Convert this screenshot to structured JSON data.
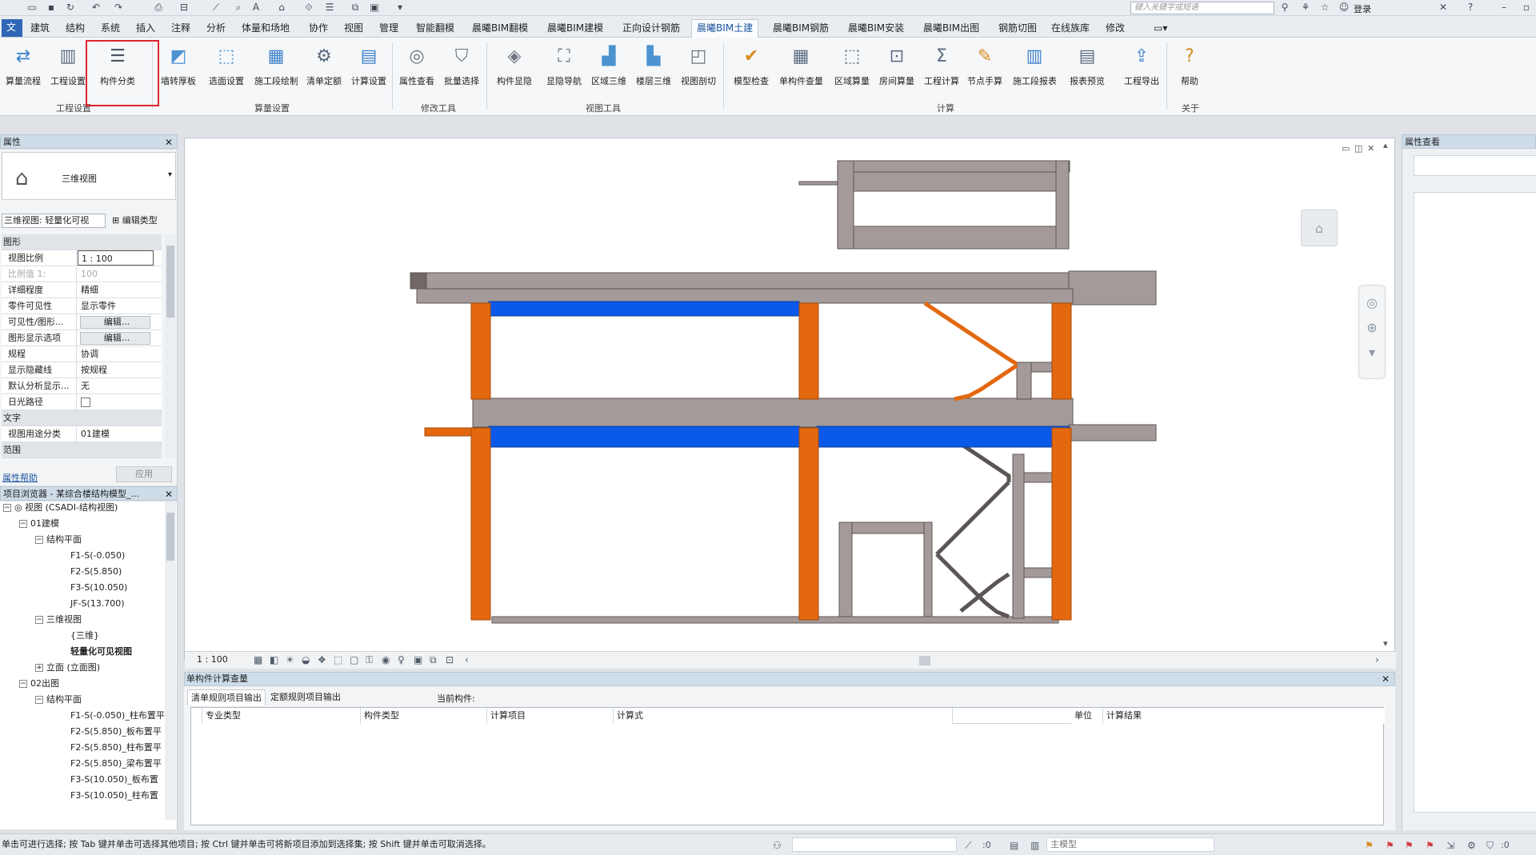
{
  "search": {
    "placeholder": "键入关键字或短语"
  },
  "login": "登录",
  "tabs": [
    "建筑",
    "结构",
    "系统",
    "插入",
    "注释",
    "分析",
    "体量和场地",
    "协作",
    "视图",
    "管理",
    "智能翻模",
    "晨曦BIM翻模",
    "晨曦BIM建模",
    "正向设计钢筋",
    "晨曦BIM土建",
    "晨曦BIM钢筋",
    "晨曦BIM安装",
    "晨曦BIM出图",
    "钢筋切图",
    "在线族库",
    "修改"
  ],
  "ribbon": {
    "buttons": [
      "算量流程",
      "工程设置",
      "构件分类",
      "墙转厚板",
      "选面设置",
      "施工段绘制",
      "清单定额",
      "计算设置",
      "属性查看",
      "批量选择",
      "构件显隐",
      "显隐导航",
      "区域三维",
      "楼层三维",
      "视图剖切",
      "模型检查",
      "单构件查量",
      "区域算量",
      "房间算量",
      "工程计算",
      "节点手算",
      "施工段报表",
      "报表预览",
      "工程导出",
      "帮助"
    ],
    "groups": [
      "工程设置",
      "算量设置",
      "修改工具",
      "视图工具",
      "计算",
      "关于"
    ]
  },
  "properties": {
    "title": "属性",
    "type_name": "三维视图",
    "instance": "三维视图: 轻量化可视",
    "edit_type": "编辑类型",
    "sections": {
      "graphics": "图形",
      "text": "文字",
      "range": "范围"
    },
    "rows": [
      {
        "name": "视图比例",
        "value": "1 : 100"
      },
      {
        "name": "比例值 1:",
        "value": "100"
      },
      {
        "name": "详细程度",
        "value": "精细"
      },
      {
        "name": "零件可见性",
        "value": "显示零件"
      },
      {
        "name": "可见性/图形...",
        "value": "编辑..."
      },
      {
        "name": "图形显示选项",
        "value": "编辑..."
      },
      {
        "name": "规程",
        "value": "协调"
      },
      {
        "name": "显示隐藏线",
        "value": "按规程"
      },
      {
        "name": "默认分析显示...",
        "value": "无"
      },
      {
        "name": "日光路径",
        "value": ""
      },
      {
        "name": "视图用途分类",
        "value": "01建模"
      }
    ],
    "help": "属性帮助",
    "apply": "应用"
  },
  "browser": {
    "title": "项目浏览器 - 某综合楼结构模型_...",
    "nodes": [
      "视图 (CSADI-结构视图)",
      "01建模",
      "结构平面",
      "F1-S(-0.050)",
      "F2-S(5.850)",
      "F3-S(10.050)",
      "JF-S(13.700)",
      "三维视图",
      "{三维}",
      "轻量化可见视图",
      "立面 (立面图)",
      "02出图",
      "结构平面",
      "F1-S(-0.050)_柱布置平",
      "F2-S(5.850)_板布置平",
      "F2-S(5.850)_柱布置平",
      "F2-S(5.850)_梁布置平",
      "F3-S(10.050)_板布置",
      "F3-S(10.050)_柱布置"
    ]
  },
  "viewbar": {
    "scale": "1 : 100"
  },
  "calc": {
    "title": "单构件计算查量",
    "tabs": [
      "清单规则项目输出",
      "定额规则项目输出"
    ],
    "current": "当前构件:",
    "columns": [
      "专业类型",
      "构件类型",
      "计算项目",
      "计算式",
      "单位",
      "计算结果"
    ]
  },
  "rightpanel": {
    "title": "属性查看"
  },
  "status": {
    "message": "单击可进行选择; 按 Tab 键并单击可选择其他项目; 按 Ctrl 键并单击可将新项目添加到选择集; 按 Shift 键并单击可取消选择。",
    "zero": ":0",
    "model": "主模型",
    "filter": ":0"
  },
  "colors": {
    "column": "#e3680f",
    "beam_blue": "#0a59e8",
    "slab": "#a39a99",
    "accent": "#1e56a0",
    "highlight": "#e0242a"
  }
}
